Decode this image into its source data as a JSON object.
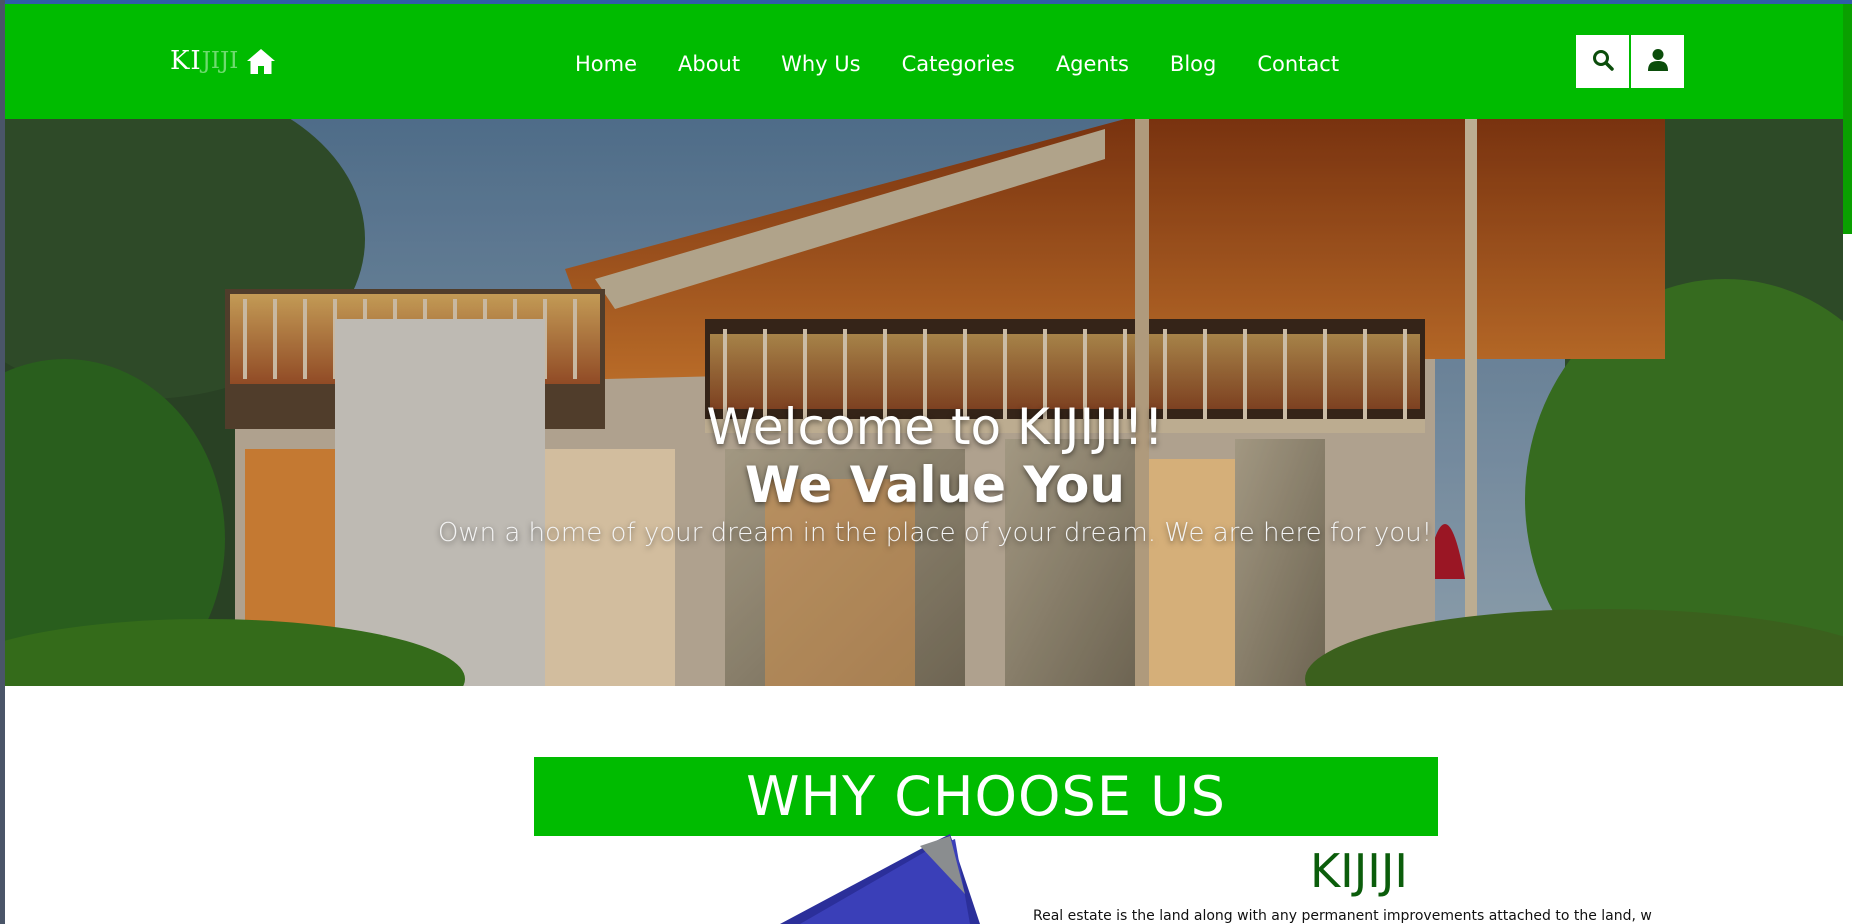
{
  "brand": {
    "logo_part1": "KI",
    "logo_part2": "JIJI",
    "logo_icon": "home-icon"
  },
  "nav": {
    "links": [
      "Home",
      "About",
      "Why Us",
      "Categories",
      "Agents",
      "Blog",
      "Contact"
    ],
    "search_icon": "search-icon",
    "user_icon": "user-icon"
  },
  "hero": {
    "title": "Welcome to KIJIJI!!",
    "subtitle": "We Value You",
    "tagline": "Own a home of your dream in the place of your dream. We are here for you!"
  },
  "why": {
    "heading": "WHY CHOOSE US",
    "about_title": "KIJIJI",
    "about_text": "Real estate is the land along with any permanent improvements attached to the land, whether"
  },
  "colors": {
    "primary_green": "#00bb00",
    "dark_green": "#0b5d0b",
    "white": "#ffffff"
  }
}
